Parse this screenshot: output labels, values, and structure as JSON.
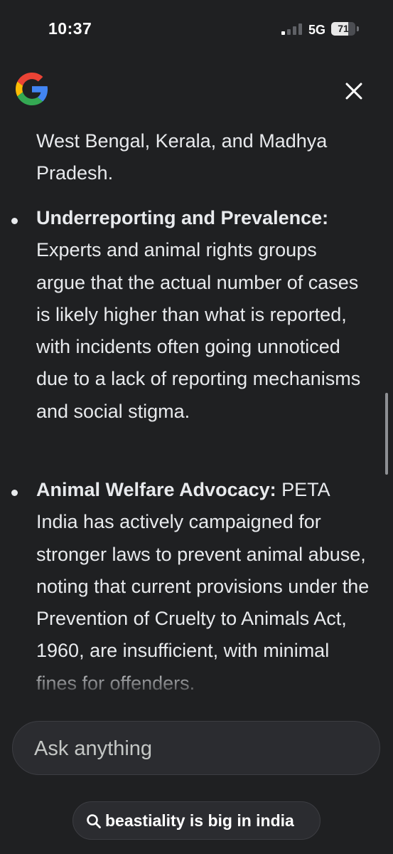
{
  "status_bar": {
    "time": "10:37",
    "network": "5G",
    "battery_level": "71",
    "signal_bars_active": 1
  },
  "header": {
    "logo_icon": "google-g-icon",
    "close_icon": "close-icon"
  },
  "content": {
    "continued_text": "West Bengal, Kerala, and Madhya Pradesh.",
    "bullets": [
      {
        "label": "Underreporting and Prevalence:",
        "text": " Experts and animal rights groups argue that the actual number of cases is likely higher than what is reported, with incidents often going unnoticed due to a lack of reporting mechanisms and social stigma."
      },
      {
        "label": "Animal Welfare Advocacy:",
        "text": " PETA India has actively campaigned for stronger laws to prevent animal abuse, noting that current provisions under the Prevention of Cruelty to Animals Act, 1960, are insufficient, with minimal fines for offenders."
      }
    ]
  },
  "input": {
    "placeholder": "Ask anything"
  },
  "query_chip": {
    "icon": "search-icon",
    "label": "beastiality is big in india"
  },
  "colors": {
    "background": "#1f2022",
    "text": "#e8eaed",
    "surface": "#2b2c30"
  }
}
